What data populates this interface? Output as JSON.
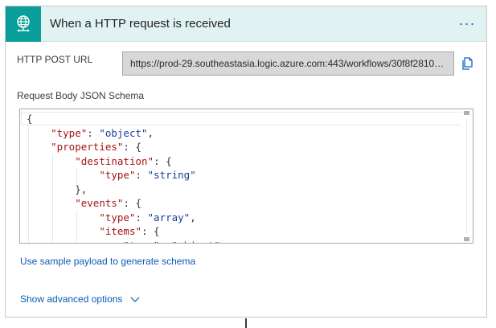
{
  "trigger": {
    "title": "When a HTTP request is received",
    "more_label": "···",
    "icon": "globe-network-icon",
    "accent_color": "#0a9e9a",
    "header_bg": "#e1f2f2"
  },
  "http_post_url": {
    "label": "HTTP POST URL",
    "value": "https://prod-29.southeastasia.logic.azure.com:443/workflows/30f8f28108...",
    "copy_icon": "copy-icon"
  },
  "schema": {
    "label": "Request Body JSON Schema",
    "lines": [
      [
        {
          "t": "{",
          "c": "punc"
        }
      ],
      [
        {
          "t": "    ",
          "c": "punc"
        },
        {
          "t": "\"type\"",
          "c": "key"
        },
        {
          "t": ": ",
          "c": "punc"
        },
        {
          "t": "\"object\"",
          "c": "str"
        },
        {
          "t": ",",
          "c": "punc"
        }
      ],
      [
        {
          "t": "    ",
          "c": "punc"
        },
        {
          "t": "\"properties\"",
          "c": "key"
        },
        {
          "t": ": {",
          "c": "punc"
        }
      ],
      [
        {
          "t": "        ",
          "c": "punc"
        },
        {
          "t": "\"destination\"",
          "c": "key"
        },
        {
          "t": ": {",
          "c": "punc"
        }
      ],
      [
        {
          "t": "            ",
          "c": "punc"
        },
        {
          "t": "\"type\"",
          "c": "key"
        },
        {
          "t": ": ",
          "c": "punc"
        },
        {
          "t": "\"string\"",
          "c": "str"
        }
      ],
      [
        {
          "t": "        },",
          "c": "punc"
        }
      ],
      [
        {
          "t": "        ",
          "c": "punc"
        },
        {
          "t": "\"events\"",
          "c": "key"
        },
        {
          "t": ": {",
          "c": "punc"
        }
      ],
      [
        {
          "t": "            ",
          "c": "punc"
        },
        {
          "t": "\"type\"",
          "c": "key"
        },
        {
          "t": ": ",
          "c": "punc"
        },
        {
          "t": "\"array\"",
          "c": "str"
        },
        {
          "t": ",",
          "c": "punc"
        }
      ],
      [
        {
          "t": "            ",
          "c": "punc"
        },
        {
          "t": "\"items\"",
          "c": "key"
        },
        {
          "t": ": {",
          "c": "punc"
        }
      ],
      [
        {
          "t": "                ",
          "c": "punc"
        },
        {
          "t": "\"type\"",
          "c": "key"
        },
        {
          "t": ": ",
          "c": "punc"
        },
        {
          "t": "\"object\"",
          "c": "str"
        },
        {
          "t": ",",
          "c": "punc"
        }
      ]
    ],
    "key_color": "#a31515",
    "string_color": "#1a3b9a"
  },
  "links": {
    "sample_payload": "Use sample payload to generate schema",
    "advanced_options": "Show advanced options",
    "advanced_icon": "chevron-down-icon"
  }
}
